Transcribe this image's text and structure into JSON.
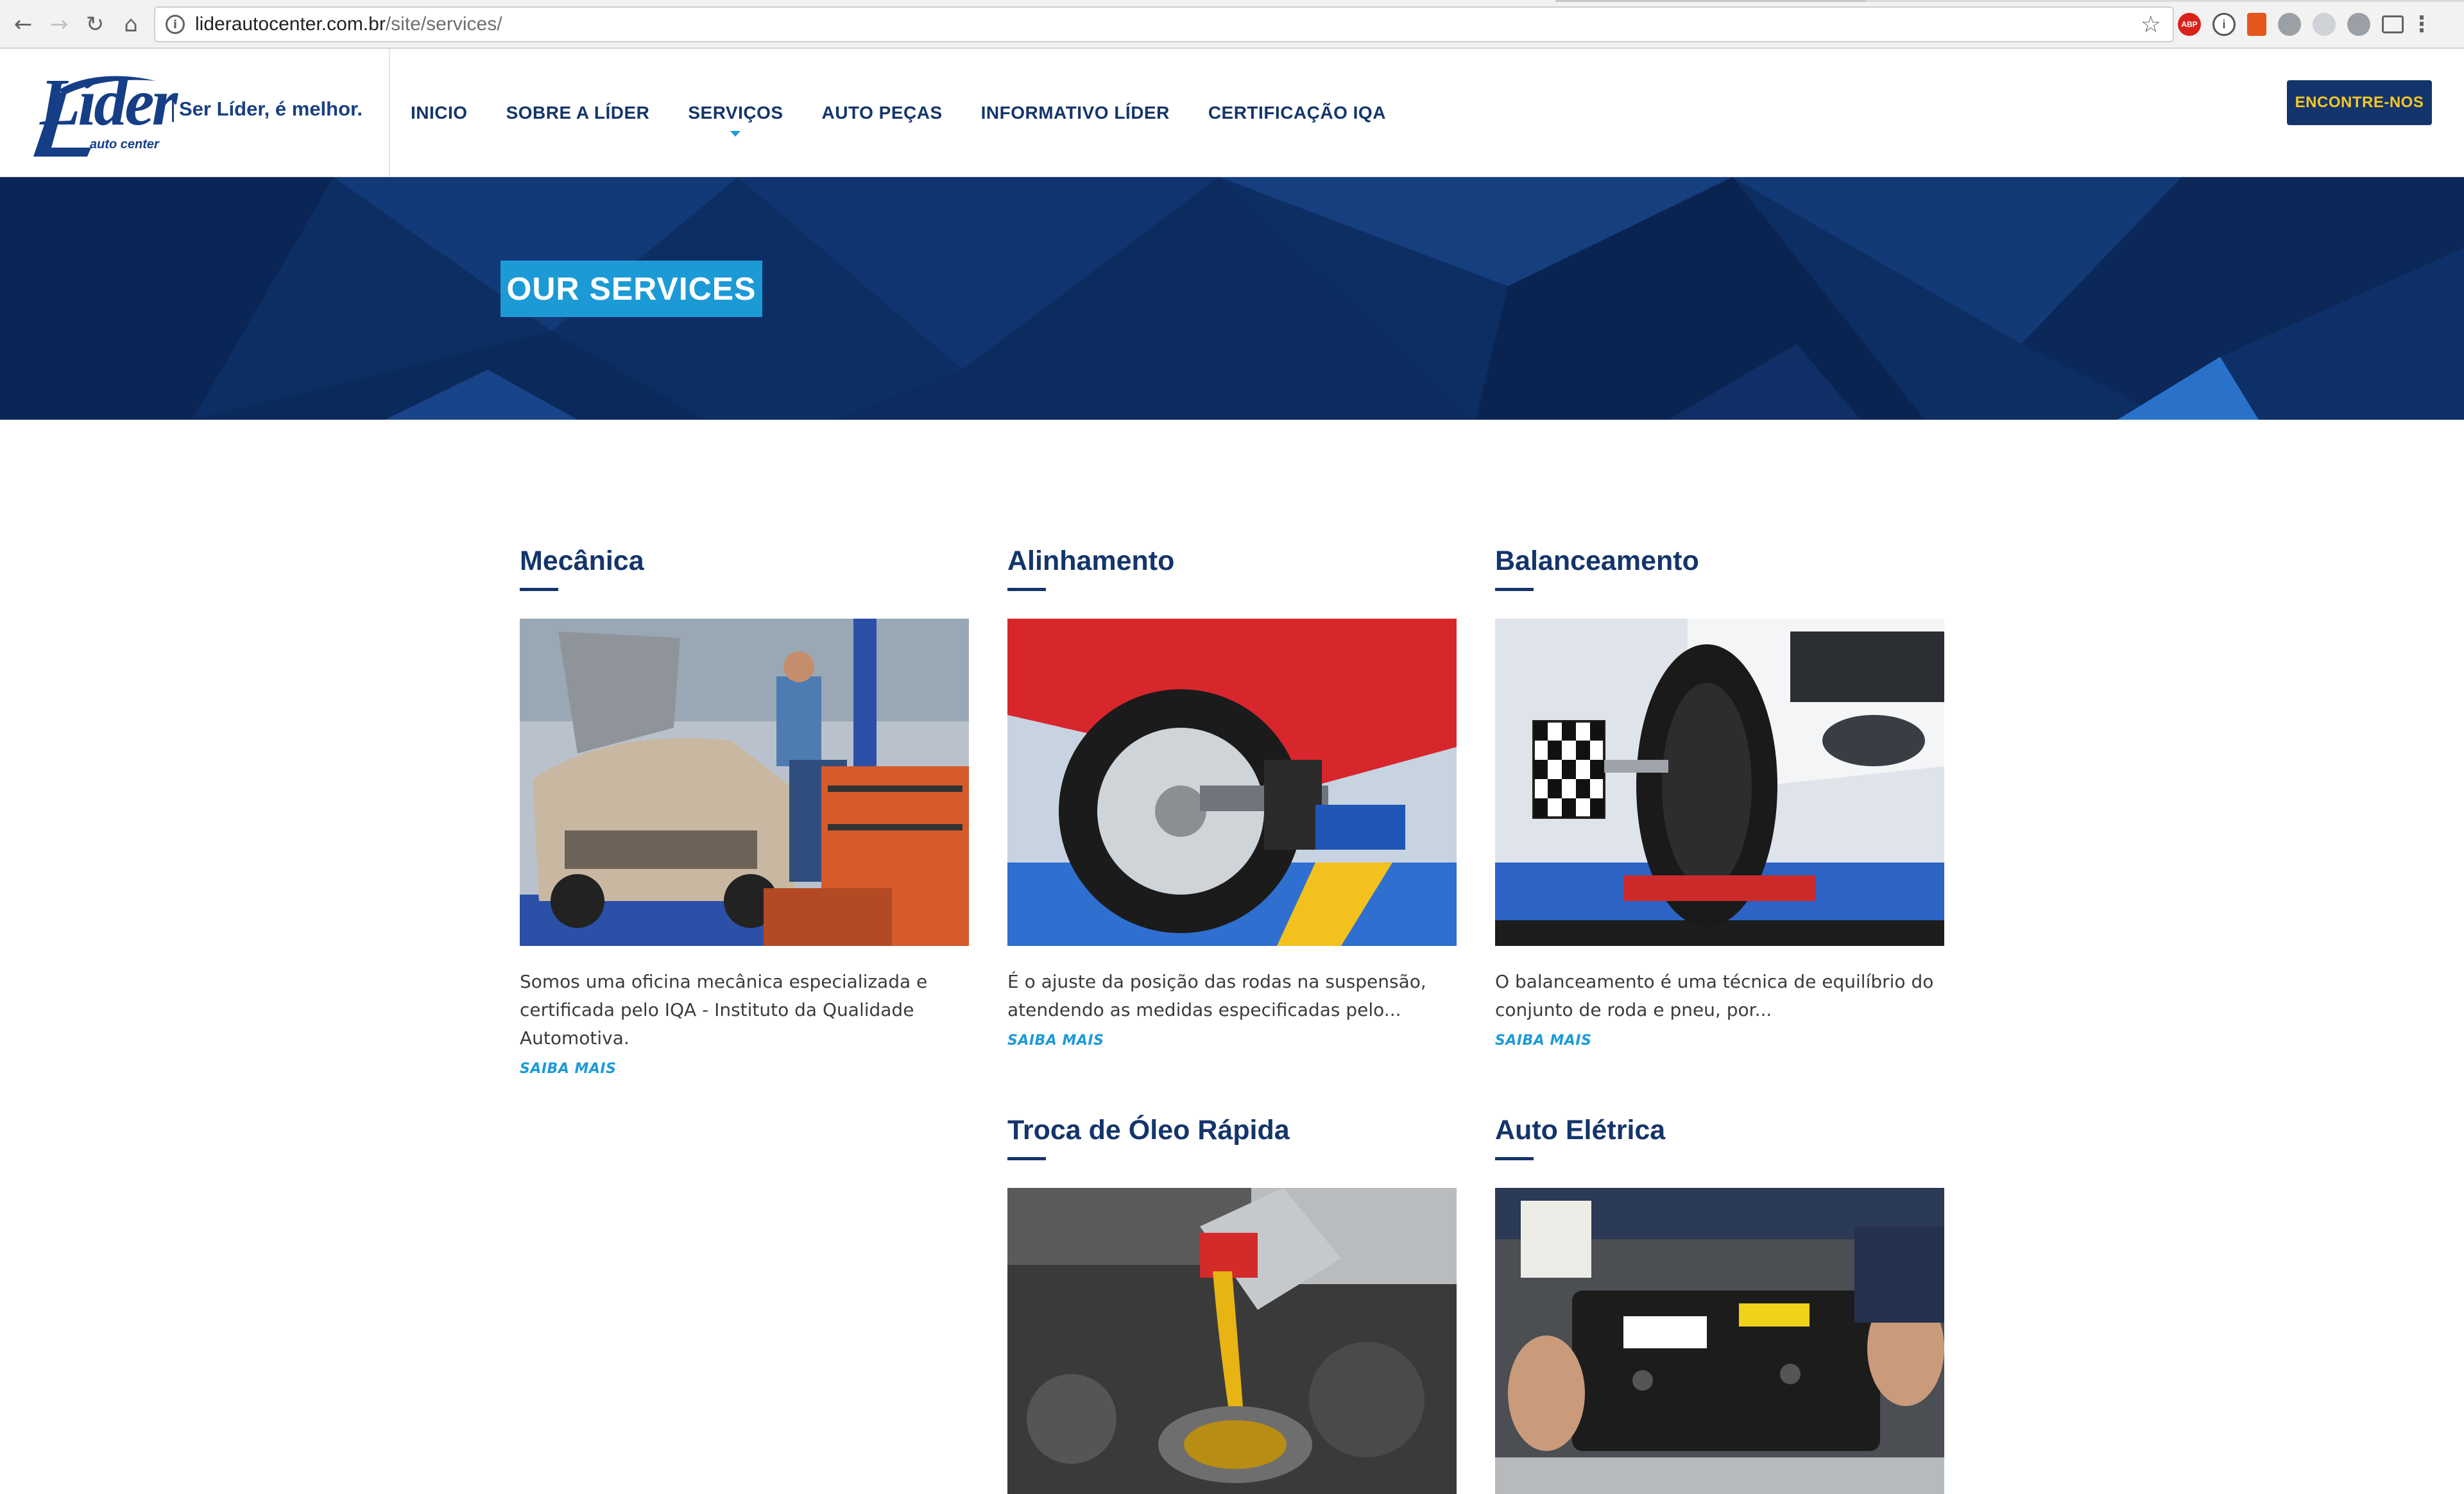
{
  "browser": {
    "url_host": "liderautocenter.com.br",
    "url_path": "/site/services/",
    "extensions": [
      "ABP"
    ]
  },
  "header": {
    "logo_text": "Líder",
    "logo_subtext": "auto center",
    "tagline": "Ser Líder, é melhor.",
    "nav": [
      {
        "label": "INICIO"
      },
      {
        "label": "SOBRE A LÍDER"
      },
      {
        "label": "SERVIÇOS",
        "active": true
      },
      {
        "label": "AUTO PEÇAS"
      },
      {
        "label": "INFORMATIVO LÍDER"
      },
      {
        "label": "CERTIFICAÇÃO IQA"
      }
    ],
    "cta_label": "ENCONTRE-NOS"
  },
  "hero": {
    "title": "OUR SERVICES"
  },
  "services": [
    {
      "title": "Mecânica",
      "description": "Somos uma oficina mecânica especializada e certificada pelo IQA - Instituto da Qualidade Automotiva.",
      "more": "SAIBA MAIS"
    },
    {
      "title": "Alinhamento",
      "description": "É o ajuste da posição das rodas na suspensão, atendendo as medidas especificadas pelo...",
      "more": "SAIBA MAIS"
    },
    {
      "title": "Balanceamento",
      "description": "O balanceamento é uma técnica de equilíbrio do conjunto de roda e pneu, por...",
      "more": "SAIBA MAIS"
    },
    {
      "title": "Troca de Óleo Rápida"
    },
    {
      "title": "Auto Elétrica"
    }
  ],
  "colors": {
    "navy": "#14356b",
    "accent_blue": "#1d9ad8",
    "cta_text": "#f7c726"
  }
}
